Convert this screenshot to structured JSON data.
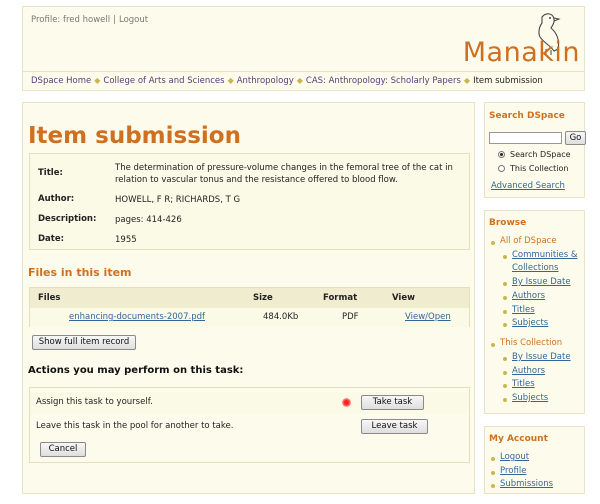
{
  "header": {
    "profile_label": "Profile: fred howell",
    "separator": "|",
    "logout_label": "Logout",
    "brand": "Manakin",
    "bird_icon": "manakin-bird-icon"
  },
  "breadcrumb": {
    "items": [
      "DSpace Home",
      "College of Arts and Sciences",
      "Anthropology",
      "CAS: Anthropology: Scholarly Papers"
    ],
    "current": "Item submission"
  },
  "main": {
    "title": "Item submission",
    "metadata": {
      "title_label": "Title:",
      "title_value": "The determination of pressure-volume changes in the femoral tree of the cat in relation to vascular tonus and the resistance offered to blood flow.",
      "author_label": "Author:",
      "author_value": "HOWELL, F R; RICHARDS, T G",
      "description_label": "Description:",
      "description_value": "pages: 414-426",
      "date_label": "Date:",
      "date_value": "1955"
    },
    "files": {
      "heading": "Files in this item",
      "columns": [
        "Files",
        "Size",
        "Format",
        "View"
      ],
      "rows": [
        {
          "file": "enhancing-documents-2007.pdf",
          "size": "484.0Kb",
          "format": "PDF",
          "view": "View/Open"
        }
      ]
    },
    "show_full_record_label": "Show full item record",
    "actions": {
      "heading": "Actions you may perform on this task:",
      "take_text": "Assign this task to yourself.",
      "take_button": "Take task",
      "leave_text": "Leave this task in the pool for another to take.",
      "leave_button": "Leave task",
      "cancel_button": "Cancel"
    }
  },
  "sidebar": {
    "search": {
      "heading": "Search DSpace",
      "go_label": "Go",
      "option_all": "Search DSpace",
      "option_collection": "This Collection",
      "selected": "Search DSpace",
      "advanced_label": "Advanced Search"
    },
    "browse": {
      "heading": "Browse",
      "all_label": "All of DSpace",
      "all_items": [
        "Communities &",
        "Collections",
        "By Issue Date",
        "Authors",
        "Titles",
        "Subjects"
      ],
      "collection_label": "This Collection",
      "collection_items": [
        "By Issue Date",
        "Authors",
        "Titles",
        "Subjects"
      ]
    },
    "account": {
      "heading": "My Account",
      "items": [
        "Logout",
        "Profile",
        "Submissions"
      ]
    }
  },
  "colors": {
    "accent": "#cf7020",
    "panel": "#fdfcec",
    "link": "#336699",
    "breadcrumb_link": "#5a3b7c"
  }
}
